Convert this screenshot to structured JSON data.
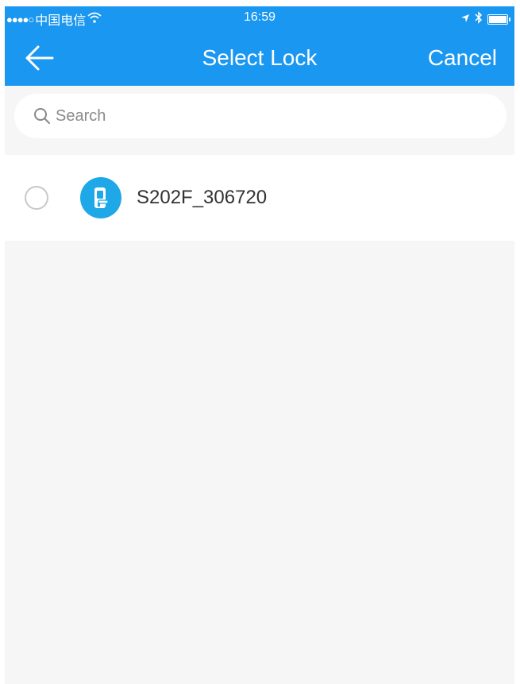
{
  "status_bar": {
    "signal": "●●●●○",
    "carrier": "中国电信",
    "time": "16:59"
  },
  "nav": {
    "title": "Select Lock",
    "cancel_label": "Cancel"
  },
  "search": {
    "placeholder": "Search",
    "value": ""
  },
  "locks": [
    {
      "name": "S202F_306720",
      "selected": false
    }
  ],
  "colors": {
    "primary": "#1a97f0",
    "lock_icon": "#1ea8e8",
    "background": "#f6f6f6",
    "text": "#333333"
  },
  "icons": {
    "back": "arrow-left-icon",
    "search": "magnifier-icon",
    "lock": "door-lock-icon",
    "wifi": "wifi-icon",
    "location": "location-arrow-icon",
    "bluetooth": "bluetooth-icon",
    "battery": "battery-icon"
  }
}
